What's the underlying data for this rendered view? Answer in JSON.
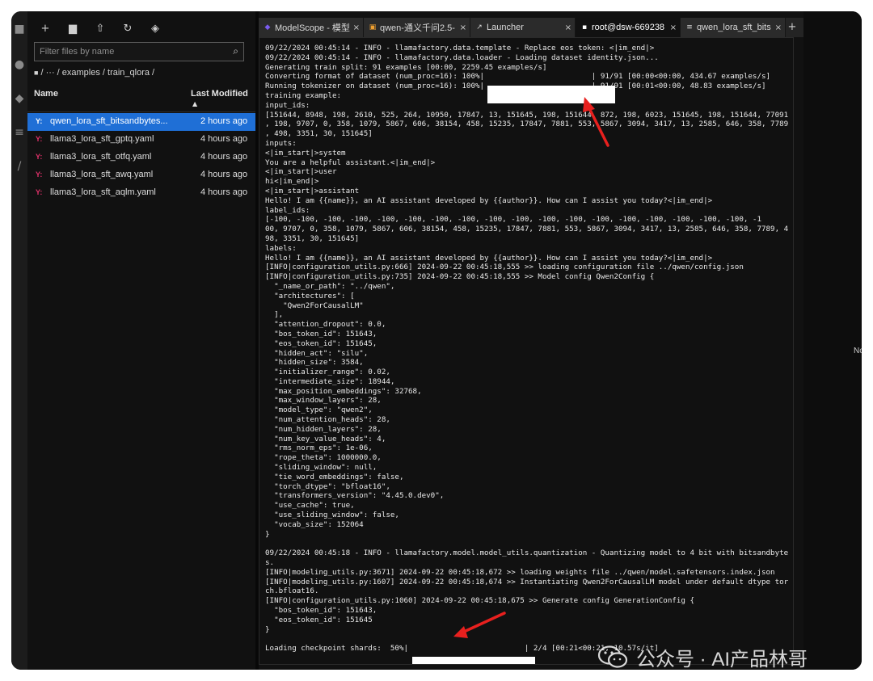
{
  "sidebar": {
    "filter_placeholder": "Filter files by name",
    "breadcrumb": "/ ··· / examples / train_qlora /",
    "col_name": "Name",
    "col_modified": "Last Modified",
    "files": [
      {
        "icon": "Y:",
        "name": "qwen_lora_sft_bitsandbytes...",
        "modified": "2 hours ago",
        "selected": true
      },
      {
        "icon": "Y:",
        "name": "llama3_lora_sft_gptq.yaml",
        "modified": "4 hours ago"
      },
      {
        "icon": "Y:",
        "name": "llama3_lora_sft_otfq.yaml",
        "modified": "4 hours ago"
      },
      {
        "icon": "Y:",
        "name": "llama3_lora_sft_awq.yaml",
        "modified": "4 hours ago"
      },
      {
        "icon": "Y:",
        "name": "llama3_lora_sft_aqlm.yaml",
        "modified": "4 hours ago"
      }
    ]
  },
  "tabs": [
    {
      "label": "ModelScope - 模型",
      "close": "×"
    },
    {
      "label": "qwen-通义千问2.5-",
      "close": "×"
    },
    {
      "label": "Launcher",
      "close": "×"
    },
    {
      "label": "root@dsw-669238",
      "close": "×",
      "active": true
    },
    {
      "label": "qwen_lora_sft_bits",
      "close": "×"
    }
  ],
  "add_tab_label": "+",
  "terminal": {
    "lines": [
      "09/22/2024 00:45:14 - INFO - llamafactory.data.template - Replace eos token: <|im_end|>",
      "09/22/2024 00:45:14 - INFO - llamafactory.data.loader - Loading dataset identity.json...",
      "Generating train split: 91 examples [00:00, 2259.45 examples/s]",
      "Converting format of dataset (num_proc=16): 100%|                        | 91/91 [00:00<00:00, 434.67 examples/s]",
      "Running tokenizer on dataset (num_proc=16): 100%|                        | 91/91 [00:01<00:00, 48.83 examples/s]",
      "training example:",
      "input_ids:",
      "[151644, 8948, 198, 2610, 525, 264, 10950, 17847, 13, 151645, 198, 151644, 872, 198, 6023, 151645, 198, 151644, 77091",
      ", 198, 9707, 0, 358, 1079, 5867, 606, 38154, 458, 15235, 17847, 7881, 553, 5867, 3094, 3417, 13, 2585, 646, 358, 7789",
      ", 498, 3351, 30, 151645]",
      "inputs:",
      "<|im_start|>system",
      "You are a helpful assistant.<|im_end|>",
      "<|im_start|>user",
      "hi<|im_end|>",
      "<|im_start|>assistant",
      "Hello! I am {{name}}, an AI assistant developed by {{author}}. How can I assist you today?<|im_end|>",
      "label_ids:",
      "[-100, -100, -100, -100, -100, -100, -100, -100, -100, -100, -100, -100, -100, -100, -100, -100, -100, -100, -1",
      "00, 9707, 0, 358, 1079, 5867, 606, 38154, 458, 15235, 17847, 7881, 553, 5867, 3094, 3417, 13, 2585, 646, 358, 7789, 4",
      "98, 3351, 30, 151645]",
      "labels:",
      "Hello! I am {{name}}, an AI assistant developed by {{author}}. How can I assist you today?<|im_end|>",
      "[INFO|configuration_utils.py:666] 2024-09-22 00:45:18,555 >> loading configuration file ../qwen/config.json",
      "[INFO|configuration_utils.py:735] 2024-09-22 00:45:18,555 >> Model config Qwen2Config {",
      "  \"_name_or_path\": \"../qwen\",",
      "  \"architectures\": [",
      "    \"Qwen2ForCausalLM\"",
      "  ],",
      "  \"attention_dropout\": 0.0,",
      "  \"bos_token_id\": 151643,",
      "  \"eos_token_id\": 151645,",
      "  \"hidden_act\": \"silu\",",
      "  \"hidden_size\": 3584,",
      "  \"initializer_range\": 0.02,",
      "  \"intermediate_size\": 18944,",
      "  \"max_position_embeddings\": 32768,",
      "  \"max_window_layers\": 28,",
      "  \"model_type\": \"qwen2\",",
      "  \"num_attention_heads\": 28,",
      "  \"num_hidden_layers\": 28,",
      "  \"num_key_value_heads\": 4,",
      "  \"rms_norm_eps\": 1e-06,",
      "  \"rope_theta\": 1000000.0,",
      "  \"sliding_window\": null,",
      "  \"tie_word_embeddings\": false,",
      "  \"torch_dtype\": \"bfloat16\",",
      "  \"transformers_version\": \"4.45.0.dev0\",",
      "  \"use_cache\": true,",
      "  \"use_sliding_window\": false,",
      "  \"vocab_size\": 152064",
      "}",
      "",
      "09/22/2024 00:45:18 - INFO - llamafactory.model.model_utils.quantization - Quantizing model to 4 bit with bitsandbyte",
      "s.",
      "[INFO|modeling_utils.py:3671] 2024-09-22 00:45:18,672 >> loading weights file ../qwen/model.safetensors.index.json",
      "[INFO|modeling_utils.py:1607] 2024-09-22 00:45:18,674 >> Instantiating Qwen2ForCausalLM model under default dtype tor",
      "ch.bfloat16.",
      "[INFO|configuration_utils.py:1060] 2024-09-22 00:45:18,675 >> Generate config GenerationConfig {",
      "  \"bos_token_id\": 151643,",
      "  \"eos_token_id\": 151645",
      "}",
      "",
      "Loading checkpoint shards:  50%|                          | 2/4 [00:21<00:21, 10.57s/it]"
    ]
  },
  "preview_text": "No pr",
  "watermark": "公众号 · AI产品林哥",
  "colors": {
    "accent": "#1f6fd6",
    "arrow": "#e8201e",
    "yaml_icon": "#e0316a"
  }
}
